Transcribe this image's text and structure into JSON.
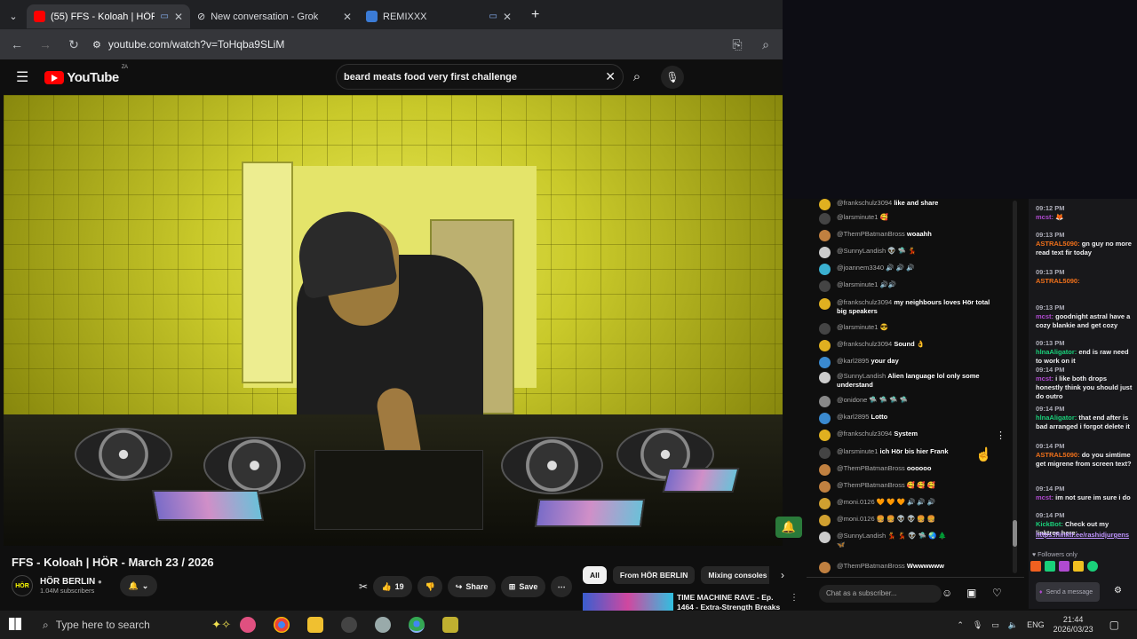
{
  "browser": {
    "tabs": [
      {
        "title": "(55) FFS - Koloah | HÖR - M",
        "color": "#ff0000",
        "active": true
      },
      {
        "title": "New conversation - Grok",
        "color": "#ffffff",
        "active": false
      },
      {
        "title": "REMIXXX",
        "color": "#3b7bd6",
        "active": false
      }
    ],
    "new_tab": "+",
    "url": "youtube.com/watch?v=ToHqba9SLiM"
  },
  "youtube": {
    "logo_text": "YouTube",
    "region": "ZA",
    "search_value": "beard meats food very first challenge"
  },
  "video": {
    "title": "FFS - Koloah | HÖR - March 23 / 2026",
    "channel": "HÖR BERLIN",
    "channel_badge": "HÖR",
    "subscribers": "1.04M subscribers",
    "likes": "19",
    "share_label": "Share",
    "save_label": "Save",
    "more_label": "⋯"
  },
  "chips": [
    "All",
    "From HÖR BERLIN",
    "Mixing consoles",
    "T"
  ],
  "related": {
    "title_line1": "TIME MACHINE RAVE - Ep.",
    "title_line2": "1464 - Extra-Strength Breaks"
  },
  "live_chat": {
    "messages": [
      {
        "user": "@frankschulz3094",
        "text": "like and share",
        "color": "#e0b020"
      },
      {
        "user": "@larsminute1",
        "text": "🥰",
        "color": "#444"
      },
      {
        "user": "@ThemPBatmanBross",
        "text": "woaahh",
        "color": "#c08040"
      },
      {
        "user": "@SunnyLandish",
        "text": "👽 🛸 💃",
        "color": "#ccc"
      },
      {
        "user": "@joannem3340",
        "text": "🔊 🔊 🔊",
        "color": "#3ab0d0"
      },
      {
        "user": "@larsminute1",
        "text": "🔊🔊",
        "color": "#444"
      },
      {
        "user": "@frankschulz3094",
        "text": "my neighbours loves Hör total",
        "text2": "big speakers",
        "color": "#e0b020"
      },
      {
        "user": "@larsminute1",
        "text": "😎",
        "color": "#444"
      },
      {
        "user": "@frankschulz3094",
        "text": "Sound 👌",
        "color": "#e0b020"
      },
      {
        "user": "@karl2895",
        "text": "your day",
        "color": "#3a8ad0"
      },
      {
        "user": "@SunnyLandish",
        "text": "Alien language lol only some",
        "text2": "understand",
        "color": "#ccc"
      },
      {
        "user": "@onidone",
        "text": "🛸 🛸 🛸 🛸",
        "color": "#888"
      },
      {
        "user": "@karl2895",
        "text": "Lotto",
        "color": "#3a8ad0"
      },
      {
        "user": "@frankschulz3094",
        "text": "System",
        "color": "#e0b020"
      },
      {
        "user": "@larsminute1",
        "text": "ich Hör bis hier Frank",
        "color": "#444"
      },
      {
        "user": "@ThemPBatmanBross",
        "text": "oooooo",
        "color": "#c08040"
      },
      {
        "user": "@ThemPBatmanBross",
        "text": "🥰 🥰 🥰",
        "color": "#c08040"
      },
      {
        "user": "@moni.0126",
        "text": "🧡 🧡 🧡 🔊 🔊 🔊",
        "color": "#d0a030"
      },
      {
        "user": "@moni.0126",
        "text": "🍔 🍔 👽 👽 🍔 🍔",
        "color": "#d0a030"
      },
      {
        "user": "@SunnyLandish",
        "text": "💃 💃 👽 🛸 🌏 🌲",
        "text2": "🦋",
        "color": "#ccc"
      },
      {
        "user": "@ThemPBatmanBross",
        "text": "Wwwwwww",
        "color": "#c08040"
      }
    ],
    "input_placeholder": "Chat as a subscriber..."
  },
  "twitch_chat": {
    "messages": [
      {
        "time": "09:12 PM",
        "user": "mcst:",
        "text": "🦊",
        "user_color": "#b04ad0"
      },
      {
        "time": "09:13 PM",
        "user": "ASTRAL5090:",
        "text": "gn guy no more read text fir today",
        "user_color": "#f0701a"
      },
      {
        "time": "09:13 PM",
        "user": "ASTRAL5090:",
        "text": "",
        "user_color": "#f0701a"
      },
      {
        "time": "09:13 PM",
        "user": "mcst:",
        "text": "goodnight astral have a cozy blankie and get cozy",
        "user_color": "#b04ad0"
      },
      {
        "time": "09:13 PM",
        "user": "hlnaAligator:",
        "text": "end is raw need to work on it",
        "user_color": "#1ad07a"
      },
      {
        "time": "09:14 PM",
        "user": "mcst:",
        "text": "i like both drops honestly think you should just do outro",
        "user_color": "#b04ad0"
      },
      {
        "time": "09:14 PM",
        "user": "hlnaAligator:",
        "text": "that end after is bad arranged i forgot delete it",
        "user_color": "#1ad07a"
      },
      {
        "time": "09:14 PM",
        "user": "ASTRAL5090:",
        "text": "do you simtime get migrene from screen text?",
        "user_color": "#f0701a"
      },
      {
        "time": "09:14 PM",
        "user": "mcst:",
        "text": "im not sure im sure i do",
        "user_color": "#b04ad0"
      },
      {
        "time": "09:14 PM",
        "user": "KickBot:",
        "text": "Check out my linktree here:",
        "user_color": "#1ad07a"
      }
    ],
    "link": "https://linktr.ee/rashidjurgens",
    "followers_only": "Followers only",
    "send_label": "Send a message"
  },
  "taskbar": {
    "search_placeholder": "Type here to search",
    "lang": "ENG",
    "time": "21:44",
    "date": "2026/03/23"
  }
}
